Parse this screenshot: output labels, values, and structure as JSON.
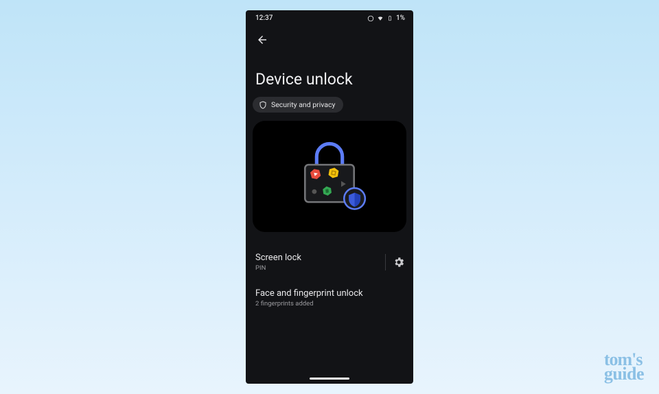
{
  "status": {
    "time": "12:37",
    "battery": "1%"
  },
  "page": {
    "title": "Device unlock"
  },
  "breadcrumb": {
    "label": "Security and privacy"
  },
  "items": {
    "screen_lock": {
      "title": "Screen lock",
      "subtitle": "PIN"
    },
    "face_fingerprint": {
      "title": "Face and fingerprint unlock",
      "subtitle": "2 fingerprints added"
    }
  },
  "watermark": {
    "line1": "tom's",
    "line2": "guide"
  }
}
